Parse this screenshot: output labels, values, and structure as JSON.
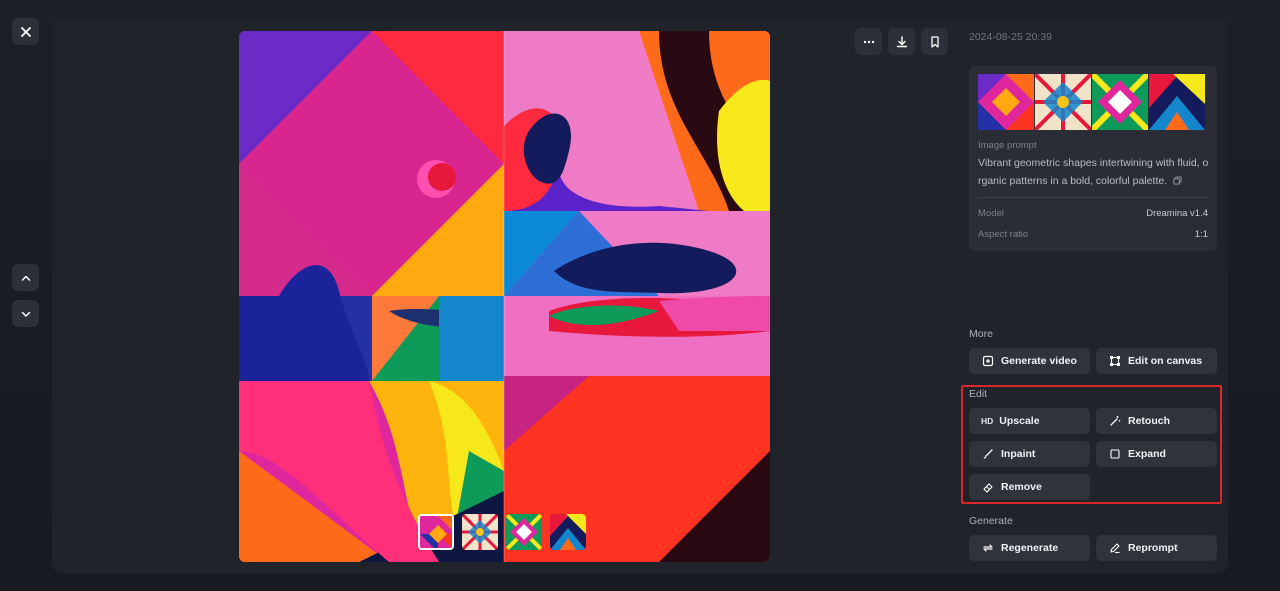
{
  "colors": {
    "accent_highlight": "#d8262b",
    "panel": "#2a2d35",
    "button": "#30333b"
  },
  "window": {
    "close_icon": "close-icon",
    "prev_icon": "chevron-up-icon",
    "next_icon": "chevron-down-icon"
  },
  "toolbar": {
    "more_icon": "ellipsis-icon",
    "download_icon": "download-icon",
    "bookmark_icon": "bookmark-icon"
  },
  "details": {
    "timestamp": "2024-08-25 20:39",
    "image_prompt_label": "Image prompt",
    "prompt_text": "Vibrant geometric shapes intertwining with fluid, o rganic patterns in a bold, colorful palette.",
    "model_label": "Model",
    "model_value": "Dreamina v1.4",
    "aspect_label": "Aspect ratio",
    "aspect_value": "1:1"
  },
  "sections": {
    "more": {
      "label": "More",
      "actions": [
        {
          "label": "Generate video",
          "icon": "video-plus-icon"
        },
        {
          "label": "Edit on canvas",
          "icon": "canvas-icon"
        }
      ]
    },
    "edit": {
      "label": "Edit",
      "hd_text": "HD",
      "actions": [
        {
          "label": "Upscale",
          "icon": "hd-icon"
        },
        {
          "label": "Retouch",
          "icon": "magic-wand-icon"
        },
        {
          "label": "Inpaint",
          "icon": "brush-icon"
        },
        {
          "label": "Expand",
          "icon": "expand-icon"
        },
        {
          "label": "Remove",
          "icon": "eraser-icon"
        }
      ]
    },
    "generate": {
      "label": "Generate",
      "actions": [
        {
          "label": "Regenerate",
          "icon": "refresh-icon"
        },
        {
          "label": "Reprompt",
          "icon": "pencil-icon"
        }
      ]
    }
  }
}
